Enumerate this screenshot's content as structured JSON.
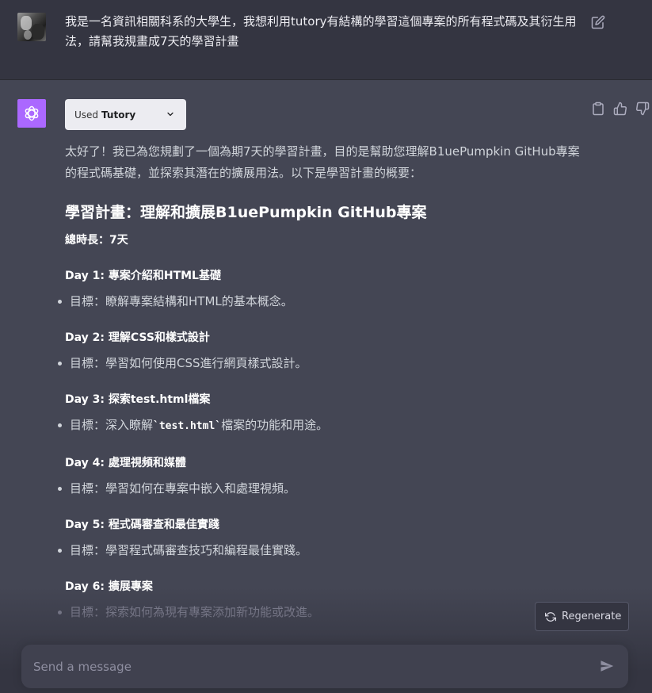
{
  "user_message": {
    "text": "我是一名資訊相關科系的大學生，我想利用tutory有結構的學習這個專案的所有程式碼及其衍生用法，請幫我規畫成7天的學習計畫"
  },
  "assistant": {
    "plugin": {
      "prefix": "Used",
      "name": "Tutory"
    },
    "intro": "太好了！我已為您規劃了一個為期7天的學習計畫，目的是幫助您理解B1uePumpkin GitHub專案的程式碼基礎，並探索其潛在的擴展用法。以下是學習計畫的概要：",
    "heading": "學習計畫：理解和擴展B1uePumpkin GitHub專案",
    "duration": "總時長：7天",
    "days": [
      {
        "title": "Day 1: 專案介紹和HTML基礎",
        "goal": "目標：瞭解專案結構和HTML的基本概念。"
      },
      {
        "title": "Day 2: 理解CSS和樣式設計",
        "goal": "目標：學習如何使用CSS進行網頁樣式設計。"
      },
      {
        "title": "Day 3: 探索test.html檔案",
        "goal_prefix": "目標：深入瞭解",
        "goal_code": "`test.html`",
        "goal_suffix": "檔案的功能和用途。"
      },
      {
        "title": "Day 4: 處理視頻和媒體",
        "goal": "目標：學習如何在專案中嵌入和處理視頻。"
      },
      {
        "title": "Day 5: 程式碼審查和最佳實踐",
        "goal": "目標：學習程式碼審查技巧和編程最佳實踐。"
      },
      {
        "title": "Day 6: 擴展專案",
        "goal": "目標：探索如何為現有專案添加新功能或改進。"
      }
    ]
  },
  "regenerate_label": "Regenerate",
  "composer": {
    "placeholder": "Send a message"
  },
  "colors": {
    "page_bg": "#444654",
    "user_row_bg": "#343541",
    "logo_bg": "#ab68ff",
    "text_primary": "#ececf1",
    "text_secondary": "#d1d5db"
  },
  "icons": [
    "edit-icon",
    "openai-logo-icon",
    "chevron-down-icon",
    "clipboard-icon",
    "thumbs-up-icon",
    "thumbs-down-icon",
    "refresh-icon",
    "send-icon"
  ]
}
